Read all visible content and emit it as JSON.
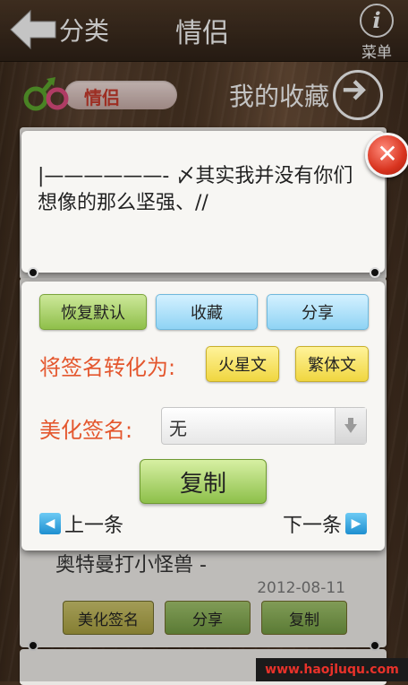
{
  "header": {
    "back_label": "分类",
    "title": "情侣",
    "menu_label": "菜单"
  },
  "subbar": {
    "category_label": "情侣",
    "favorites_label": "我的收藏"
  },
  "popup": {
    "signature_text": "|——————- 〆其实我并没有你们想像的那么坚强、//",
    "buttons": {
      "reset": "恢复默认",
      "collect": "收藏",
      "share": "分享"
    },
    "convert_label": "将签名转化为:",
    "convert_options": [
      "火星文",
      "繁体文"
    ],
    "beautify_label": "美化签名:",
    "beautify_selected": "无",
    "copy_label": "复制",
    "prev_label": "上一条",
    "next_label": "下一条"
  },
  "background_card": {
    "text": "奥特曼打小怪兽 -",
    "date": "2012-08-11",
    "buttons": {
      "beautify": "美化签名",
      "share": "分享",
      "copy": "复制"
    }
  },
  "watermark": "www.haojluqu.com",
  "colors": {
    "accent_orange": "#e4572e",
    "close_red": "#d8341f",
    "nav_blue": "#1e8fd0"
  }
}
